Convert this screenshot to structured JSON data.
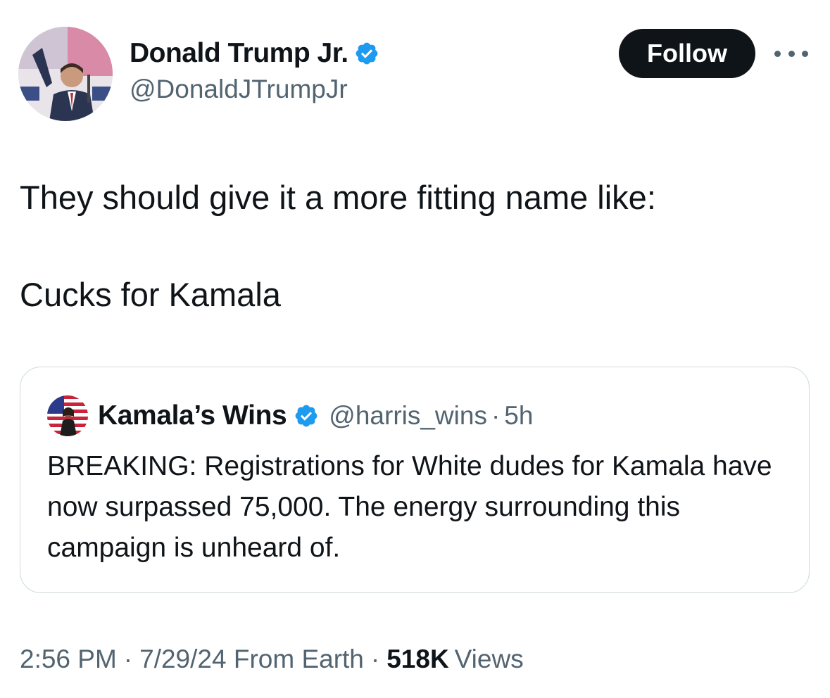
{
  "author": {
    "name": "Donald Trump Jr.",
    "handle": "@DonaldJTrumpJr",
    "verified": true
  },
  "actions": {
    "follow_label": "Follow",
    "more_icon": "more-horizontal-icon"
  },
  "tweet": {
    "line1": "They should give it a more fitting name like:",
    "line2": "Cucks for Kamala"
  },
  "quote": {
    "name": "Kamala’s Wins",
    "handle": "@harris_wins",
    "separator": "·",
    "time": "5h",
    "text": "BREAKING: Registrations for White dudes for Kamala have now surpassed 75,000. The energy surrounding this campaign is unheard of."
  },
  "meta": {
    "time": "2:56 PM",
    "date_source": "7/29/24 From Earth",
    "separator": "·",
    "views_count": "518K",
    "views_label": "Views"
  },
  "colors": {
    "verified_blue": "#1d9bf0",
    "text_primary": "#0f1419",
    "text_secondary": "#536471",
    "border": "#cfd9de",
    "follow_bg": "#0f1419"
  }
}
